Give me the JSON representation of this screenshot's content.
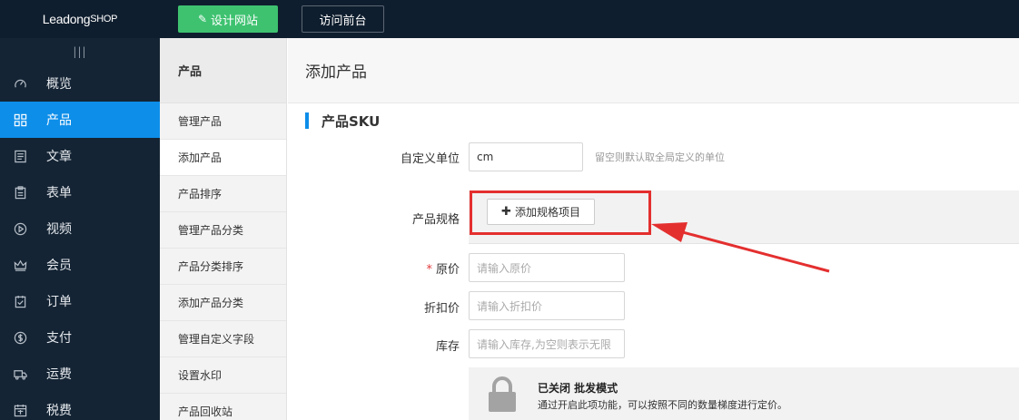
{
  "topbar": {
    "logo_main": "Leadong",
    "logo_shop": "SHOP",
    "design_btn": "设计网站",
    "visit_btn": "访问前台"
  },
  "sidebar": {
    "collapse_glyph": "|||",
    "items": [
      {
        "label": "概览",
        "icon": "gauge-icon"
      },
      {
        "label": "产品",
        "icon": "grid-icon"
      },
      {
        "label": "文章",
        "icon": "article-icon"
      },
      {
        "label": "表单",
        "icon": "clipboard-icon"
      },
      {
        "label": "视频",
        "icon": "play-icon"
      },
      {
        "label": "会员",
        "icon": "crown-icon"
      },
      {
        "label": "订单",
        "icon": "order-icon"
      },
      {
        "label": "支付",
        "icon": "dollar-icon"
      },
      {
        "label": "运费",
        "icon": "truck-icon"
      },
      {
        "label": "税费",
        "icon": "tax-icon"
      }
    ],
    "active_index": 1,
    "active_color": "#0d8ee9"
  },
  "subnav": {
    "title": "产品",
    "items": [
      "管理产品",
      "添加产品",
      "产品排序",
      "管理产品分类",
      "产品分类排序",
      "添加产品分类",
      "管理自定义字段",
      "设置水印",
      "产品回收站"
    ],
    "active_index": 1
  },
  "main": {
    "page_title": "添加产品",
    "section_title": "产品SKU",
    "unit": {
      "label": "自定义单位",
      "value": "cm",
      "hint": "留空则默认取全局定义的单位"
    },
    "spec": {
      "label": "产品规格",
      "add_btn": "添加规格项目"
    },
    "price": {
      "required_mark": "*",
      "label": "原价",
      "placeholder": "请输入原价"
    },
    "discount": {
      "label": "折扣价",
      "placeholder": "请输入折扣价"
    },
    "stock": {
      "label": "库存",
      "placeholder": "请输入库存,为空则表示无限"
    },
    "wholesale": {
      "title": "已关闭 批发模式",
      "desc": "通过开启此项功能，可以按照不同的数量梯度进行定价。",
      "icon": "lock-icon"
    }
  },
  "annotation_color": "#e42f2f"
}
